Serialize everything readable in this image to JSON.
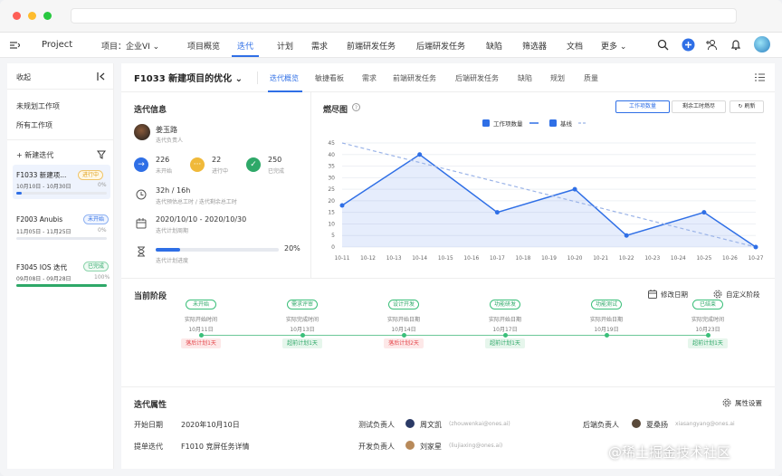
{
  "colors": {
    "accent": "#2f6fe6",
    "green": "#2ea868",
    "orange": "#f0b93a",
    "red": "#e5484d"
  },
  "topnav": {
    "project_label": "Project",
    "project_select": "项目：企业VI ⌄",
    "items": [
      "项目概览",
      "迭代",
      "计划",
      "需求",
      "前端研发任务",
      "后端研发任务",
      "缺陷",
      "筛选器",
      "文档",
      "更多 ⌄"
    ],
    "active_index": 1
  },
  "sidebar": {
    "collapse_label": "收起",
    "unplanned": "未规划工作项",
    "all": "所有工作项",
    "new_iteration": "+ 新建迭代",
    "iterations": [
      {
        "name": "F1033 新建项...",
        "tag": "进行中",
        "dates": "10月10日 - 10月30日",
        "progress_text": "0%",
        "progress": 0.06
      },
      {
        "name": "F2003 Anubis",
        "tag": "未开始",
        "dates": "11月05日 - 11月25日",
        "progress_text": "0%",
        "progress": 0
      },
      {
        "name": "F3045 IOS 迭代",
        "tag": "已完成",
        "dates": "09月08日 - 09月28日",
        "progress_text": "100%",
        "progress": 1
      }
    ]
  },
  "main": {
    "title": "F1033 新建项目的优化 ⌄",
    "tabs": [
      "迭代概览",
      "敏捷看板",
      "需求",
      "前端研发任务",
      "后端研发任务",
      "缺陷",
      "规划",
      "质量"
    ],
    "active_tab": 0
  },
  "info": {
    "title": "迭代信息",
    "owner_name": "姜玉路",
    "owner_role": "迭代负责人",
    "stats": [
      {
        "value": "226",
        "label": "未开始",
        "icon": "arrow-right-icon"
      },
      {
        "value": "22",
        "label": "进行中",
        "icon": "dots-icon"
      },
      {
        "value": "250",
        "label": "已完成",
        "icon": "check-icon"
      }
    ],
    "time_value": "32h / 16h",
    "time_label": "迭代预估总工时 / 迭代剩余总工时",
    "period_value": "2020/10/10 - 2020/10/30",
    "period_label": "迭代计划周期",
    "progress_value": "20%",
    "progress_label": "迭代计划进度",
    "progress": 0.2
  },
  "burndown": {
    "title": "燃尽图",
    "btn_work": "工作项数量",
    "btn_hours": "剩余工时燃尽",
    "btn_refresh": "刷新",
    "legend_series": "工作项数量",
    "legend_baseline": "基线"
  },
  "chart_data": {
    "type": "line",
    "x": [
      "10-11",
      "10-12",
      "10-13",
      "10-14",
      "10-15",
      "10-16",
      "10-17",
      "10-18",
      "10-19",
      "10-20",
      "10-21",
      "10-22",
      "10-23",
      "10-24",
      "10-25",
      "10-26",
      "10-27"
    ],
    "series": [
      {
        "name": "工作项数量",
        "values": [
          18,
          null,
          null,
          40,
          null,
          null,
          15,
          null,
          null,
          25,
          null,
          5,
          null,
          null,
          15,
          null,
          0
        ]
      },
      {
        "name": "基线",
        "values": [
          45,
          null,
          null,
          null,
          null,
          null,
          null,
          null,
          null,
          null,
          null,
          null,
          null,
          null,
          null,
          null,
          0
        ]
      }
    ],
    "yticks": [
      0,
      5,
      10,
      15,
      20,
      25,
      30,
      35,
      40,
      45
    ],
    "ylim": [
      0,
      45
    ],
    "grid": true,
    "legend_position": "top-right"
  },
  "stages": {
    "title": "当前阶段",
    "edit_date": "修改日期",
    "custom_stage": "自定义阶段",
    "items": [
      {
        "name": "未开始",
        "note1": "实际开始时间",
        "note2": "10月11日",
        "tag": "落后计划1天",
        "tag_type": "late"
      },
      {
        "name": "需求评审",
        "note1": "实际完成时间",
        "note2": "10月13日",
        "tag": "超前计划1天",
        "tag_type": "early"
      },
      {
        "name": "设计开发",
        "note1": "实际开始日期",
        "note2": "10月14日",
        "tag": "落后计划2天",
        "tag_type": "late"
      },
      {
        "name": "功能研发",
        "note1": "实际开始日期",
        "note2": "10月17日",
        "tag": "超前计划1天",
        "tag_type": "early"
      },
      {
        "name": "功能测试",
        "note1": "实际开始日期",
        "note2": "10月19日",
        "tag": "",
        "tag_type": "none"
      },
      {
        "name": "已结束",
        "note1": "实际完成时间",
        "note2": "10月23日",
        "tag": "超前计划1天",
        "tag_type": "early"
      }
    ]
  },
  "attrs": {
    "title": "迭代属性",
    "settings": "属性设置",
    "start_label": "开始日期",
    "start_value": "2020年10月10日",
    "prev_label": "提单迭代",
    "prev_value": "F1010 竞屏任务详情",
    "test_label": "测试负责人",
    "test_name": "周文凯",
    "test_mail": "(zhouwenkai@ones.ai)",
    "dev_label": "开发负责人",
    "dev_name": "刘家星",
    "dev_mail": "(liujiaxing@ones.ai)",
    "backend_label": "后端负责人",
    "backend_name": "夏桑扬",
    "backend_mail": "xiasangyang@ones.ai"
  },
  "watermark": "@稀土掘金技术社区"
}
